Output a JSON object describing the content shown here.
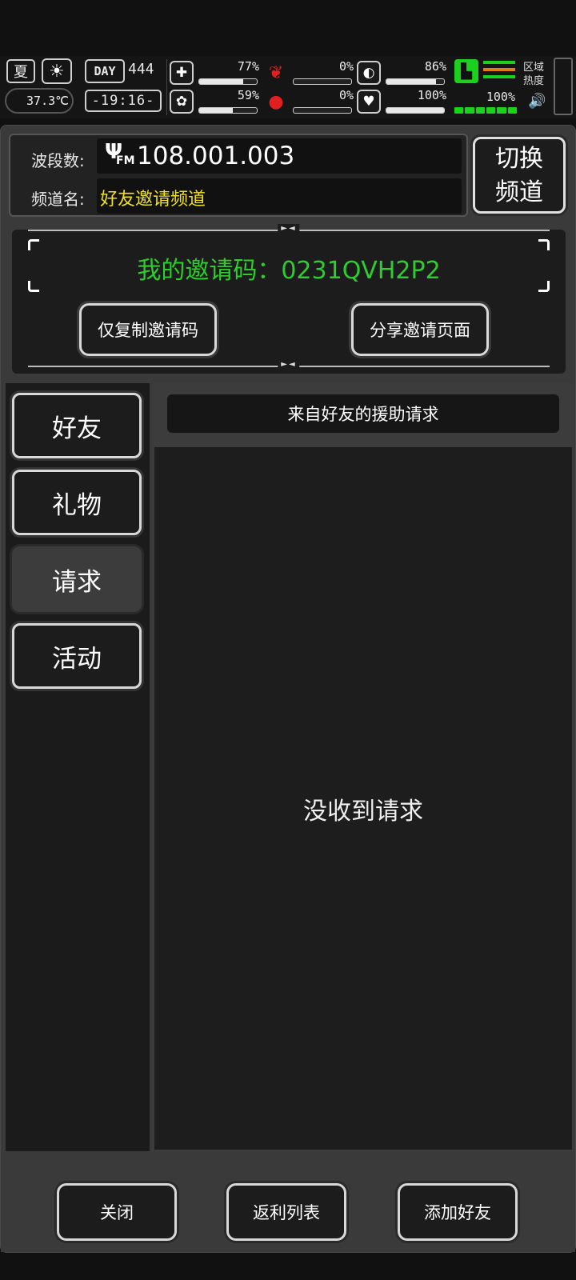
{
  "status": {
    "season": "夏",
    "temperature": "37.3℃",
    "day_label": "DAY",
    "day_number": "444",
    "time": "-19:16-",
    "stats": [
      {
        "id": "health",
        "icon": "first-aid-icon",
        "value": "77%",
        "level": 0.77,
        "danger": false
      },
      {
        "id": "hunger",
        "icon": "stomach-icon",
        "value": "0%",
        "level": 0.0,
        "danger": true
      },
      {
        "id": "energy",
        "icon": "capsule-icon",
        "value": "86%",
        "level": 0.86,
        "danger": false
      },
      {
        "id": "mind",
        "icon": "brain-icon",
        "value": "59%",
        "level": 0.59,
        "danger": false
      },
      {
        "id": "thirst",
        "icon": "blood-drop-icon",
        "value": "0%",
        "level": 0.0,
        "danger": true
      },
      {
        "id": "mood",
        "icon": "heart-icon",
        "value": "100%",
        "level": 1.0,
        "danger": false
      }
    ],
    "stamina": {
      "value": "100%",
      "level": 1.0
    },
    "region_label": "区域热度",
    "colors": {
      "accent_green": "#1bd11b",
      "danger_red": "#e02020",
      "stripe_orange": "#e07a1e"
    }
  },
  "radio": {
    "band_label": "波段数:",
    "band_value": "108.001.003",
    "fm_label": "FM",
    "channel_label": "频道名:",
    "channel_name": "好友邀请频道",
    "switch_label_1": "切换",
    "switch_label_2": "频道"
  },
  "invite": {
    "code_text": "我的邀请码：0231QVH2P2",
    "copy_button": "仅复制邀请码",
    "share_button": "分享邀请页面"
  },
  "tabs": [
    {
      "label": "好友",
      "active": false
    },
    {
      "label": "礼物",
      "active": false
    },
    {
      "label": "请求",
      "active": true
    },
    {
      "label": "活动",
      "active": false
    }
  ],
  "content": {
    "header": "来自好友的援助请求",
    "empty_message": "没收到请求"
  },
  "footer": {
    "close_button": "关闭",
    "rebate_button": "返利列表",
    "add_friend_button": "添加好友"
  }
}
